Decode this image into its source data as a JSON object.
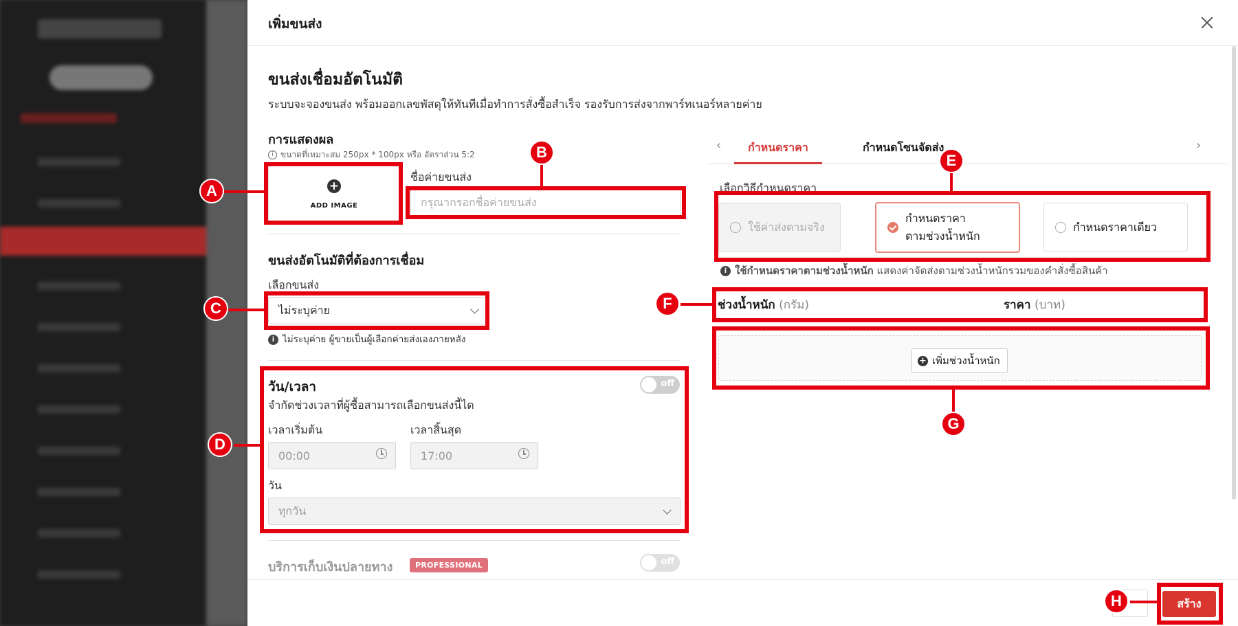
{
  "modal": {
    "title": "เพิ่มขนส่ง",
    "section_title": "ขนส่งเชื่อมอัตโนมัติ",
    "section_desc": "ระบบจะจองขนส่ง พร้อมออกเลขพัสดุให้ทันทีเมื่อทำการสั่งซื้อสำเร็จ รองรับการส่งจากพาร์ทเนอร์หลายค่าย"
  },
  "display": {
    "label": "การแสดงผล",
    "hint": "ขนาดที่เหมาะสม 250px * 100px หรือ อัตราส่วน 5:2",
    "add_image": "ADD IMAGE",
    "name_label": "ชื่อค่ายขนส่ง",
    "name_placeholder": "กรุณากรอกชื่อค่ายขนส่ง"
  },
  "carrier": {
    "section_label": "ขนส่งอัตโนมัติที่ต้องการเชื่อม",
    "select_label": "เลือกขนส่ง",
    "selected": "ไม่ระบุค่าย",
    "note": "ไม่ระบุค่าย ผู้ขายเป็นผู้เลือกค่ายส่งเองภายหลัง"
  },
  "datetime": {
    "label": "วัน/เวลา",
    "toggle": "off",
    "desc": "จำกัดช่วงเวลาที่ผู้ซื้อสามารถเลือกขนส่งนี้ได",
    "start_label": "เวลาเริ่มต้น",
    "start_value": "00:00",
    "end_label": "เวลาสิ้นสุด",
    "end_value": "17:00",
    "day_label": "วัน",
    "day_value": "ทุกวัน"
  },
  "cod": {
    "label": "บริการเก็บเงินปลายทาง",
    "badge": "PROFESSIONAL",
    "toggle": "off"
  },
  "tabs": [
    {
      "label": "กำหนดราคา",
      "active": true
    },
    {
      "label": "กำหนดโซนจัดส่ง",
      "active": false
    }
  ],
  "pricing": {
    "method_label": "เลือกวิธีกำหนดราคา",
    "options": [
      {
        "label": "ใช้ค่าส่งตามจริง",
        "state": "disabled"
      },
      {
        "label_line1": "กำหนดราคา",
        "label_line2": "ตามช่วงน้ำหนัก",
        "state": "selected"
      },
      {
        "label": "กำหนดราคาเดียว",
        "state": "normal"
      }
    ],
    "info_bold": "ใช้กำหนดราคาตามช่วงน้ำหนัก",
    "info_rest": "แสดงค่าจัดส่งตามช่วงน้ำหนักรวมของคำสั่งซื้อสินค้า",
    "col_weight": "ช่วงน้ำหนัก",
    "col_weight_unit": "(กรัม)",
    "col_price": "ราคา",
    "col_price_unit": "(บาท)",
    "add_weight": "เพิ่มช่วงน้ำหนัก"
  },
  "footer": {
    "create": "สร้าง"
  },
  "annotations": [
    "A",
    "B",
    "C",
    "D",
    "E",
    "F",
    "G",
    "H"
  ],
  "colors": {
    "accent": "#d63a3a",
    "annotation": "#e4000f",
    "create_button": "#d9362f"
  }
}
